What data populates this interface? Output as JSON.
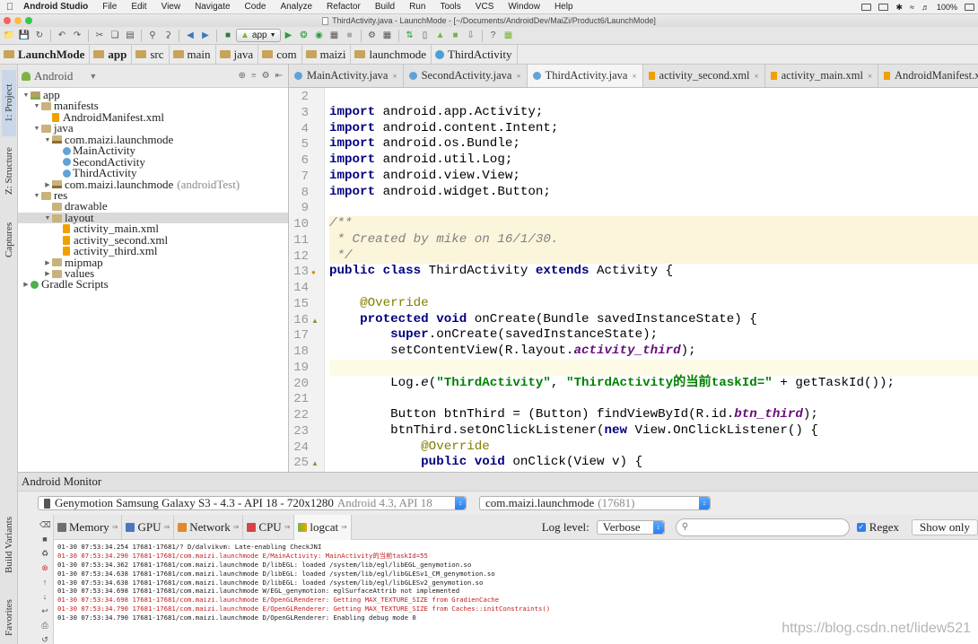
{
  "menubar": {
    "app_name": "Android Studio",
    "items": [
      "File",
      "Edit",
      "View",
      "Navigate",
      "Code",
      "Analyze",
      "Refactor",
      "Build",
      "Run",
      "Tools",
      "VCS",
      "Window",
      "Help"
    ],
    "battery": "100%"
  },
  "window": {
    "title": "ThirdActivity.java - LaunchMode - [~/Documents/AndroidDev/MaiZi/Product6/LaunchMode]"
  },
  "toolbar": {
    "run_config": "app"
  },
  "breadcrumb": [
    "LaunchMode",
    "app",
    "src",
    "main",
    "java",
    "com",
    "maizi",
    "launchmode",
    "ThirdActivity"
  ],
  "left_strip": {
    "tabs": [
      "1: Project",
      "Z: Structure",
      "Captures",
      "Build Variants",
      "Favorites"
    ]
  },
  "project": {
    "view": "Android",
    "tree": [
      {
        "label": "app",
        "depth": 0,
        "icon": "folder-android",
        "arrow": "down"
      },
      {
        "label": "manifests",
        "depth": 1,
        "icon": "folder",
        "arrow": "down"
      },
      {
        "label": "AndroidManifest.xml",
        "depth": 2,
        "icon": "xml",
        "arrow": ""
      },
      {
        "label": "java",
        "depth": 1,
        "icon": "folder",
        "arrow": "down"
      },
      {
        "label": "com.maizi.launchmode",
        "depth": 2,
        "icon": "pkg",
        "arrow": "down"
      },
      {
        "label": "MainActivity",
        "depth": 3,
        "icon": "cls",
        "arrow": ""
      },
      {
        "label": "SecondActivity",
        "depth": 3,
        "icon": "cls",
        "arrow": ""
      },
      {
        "label": "ThirdActivity",
        "depth": 3,
        "icon": "cls",
        "arrow": ""
      },
      {
        "label": "com.maizi.launchmode",
        "depth": 2,
        "icon": "pkg",
        "arrow": "right",
        "note": "(androidTest)"
      },
      {
        "label": "res",
        "depth": 1,
        "icon": "folder",
        "arrow": "down"
      },
      {
        "label": "drawable",
        "depth": 2,
        "icon": "folder",
        "arrow": ""
      },
      {
        "label": "layout",
        "depth": 2,
        "icon": "folder",
        "arrow": "down",
        "selected": true
      },
      {
        "label": "activity_main.xml",
        "depth": 3,
        "icon": "xml",
        "arrow": ""
      },
      {
        "label": "activity_second.xml",
        "depth": 3,
        "icon": "xml",
        "arrow": ""
      },
      {
        "label": "activity_third.xml",
        "depth": 3,
        "icon": "xml",
        "arrow": ""
      },
      {
        "label": "mipmap",
        "depth": 2,
        "icon": "folder",
        "arrow": "right"
      },
      {
        "label": "values",
        "depth": 2,
        "icon": "folder",
        "arrow": "right"
      },
      {
        "label": "Gradle Scripts",
        "depth": 0,
        "icon": "gradle",
        "arrow": "right"
      }
    ]
  },
  "editor": {
    "tabs": [
      {
        "label": "MainActivity.java",
        "type": "java",
        "active": false
      },
      {
        "label": "SecondActivity.java",
        "type": "java",
        "active": false
      },
      {
        "label": "ThirdActivity.java",
        "type": "java",
        "active": true
      },
      {
        "label": "activity_second.xml",
        "type": "xml",
        "active": false
      },
      {
        "label": "activity_main.xml",
        "type": "xml",
        "active": false
      },
      {
        "label": "AndroidManifest.xml",
        "type": "xml",
        "active": false
      }
    ],
    "line_numbers": [
      "2",
      "3",
      "4",
      "5",
      "6",
      "7",
      "8",
      "9",
      "10",
      "11",
      "12",
      "13",
      "14",
      "15",
      "16",
      "17",
      "18",
      "19",
      "20",
      "21",
      "22",
      "23",
      "24",
      "25"
    ],
    "lines": [
      [],
      [
        {
          "t": "import",
          "c": "kw"
        },
        {
          "t": " android.app.Activity;",
          "c": ""
        }
      ],
      [
        {
          "t": "import",
          "c": "kw"
        },
        {
          "t": " android.content.Intent;",
          "c": ""
        }
      ],
      [
        {
          "t": "import",
          "c": "kw"
        },
        {
          "t": " android.os.Bundle;",
          "c": ""
        }
      ],
      [
        {
          "t": "import",
          "c": "kw"
        },
        {
          "t": " android.util.Log;",
          "c": ""
        }
      ],
      [
        {
          "t": "import",
          "c": "kw"
        },
        {
          "t": " android.view.View;",
          "c": ""
        }
      ],
      [
        {
          "t": "import",
          "c": "kw"
        },
        {
          "t": " android.widget.Button;",
          "c": ""
        }
      ],
      [],
      [
        {
          "t": "/**",
          "c": "cmt"
        }
      ],
      [
        {
          "t": " * Created by mike on 16/1/30.",
          "c": "cmt"
        }
      ],
      [
        {
          "t": " */",
          "c": "cmt"
        }
      ],
      [
        {
          "t": "public class",
          "c": "kw"
        },
        {
          "t": " ThirdActivity ",
          "c": ""
        },
        {
          "t": "extends",
          "c": "kw"
        },
        {
          "t": " Activity {",
          "c": ""
        }
      ],
      [],
      [
        {
          "t": "    ",
          "c": ""
        },
        {
          "t": "@Override",
          "c": "ann"
        }
      ],
      [
        {
          "t": "    ",
          "c": ""
        },
        {
          "t": "protected void",
          "c": "kw"
        },
        {
          "t": " onCreate(Bundle savedInstanceState) {",
          "c": ""
        }
      ],
      [
        {
          "t": "        ",
          "c": ""
        },
        {
          "t": "super",
          "c": "kw"
        },
        {
          "t": ".onCreate(savedInstanceState);",
          "c": ""
        }
      ],
      [
        {
          "t": "        setContentView(R.layout.",
          "c": ""
        },
        {
          "t": "activity_third",
          "c": "fld"
        },
        {
          "t": ");",
          "c": ""
        }
      ],
      [],
      [
        {
          "t": "        Log.",
          "c": ""
        },
        {
          "t": "e",
          "c": "sm"
        },
        {
          "t": "(",
          "c": ""
        },
        {
          "t": "\"ThirdActivity\"",
          "c": "str"
        },
        {
          "t": ", ",
          "c": ""
        },
        {
          "t": "\"ThirdActivity的当前taskId=\"",
          "c": "str"
        },
        {
          "t": " + getTaskId());",
          "c": ""
        }
      ],
      [],
      [
        {
          "t": "        Button btnThird = (Button) findViewById(R.id.",
          "c": ""
        },
        {
          "t": "btn_third",
          "c": "fld"
        },
        {
          "t": ");",
          "c": ""
        }
      ],
      [
        {
          "t": "        btnThird.setOnClickListener(",
          "c": ""
        },
        {
          "t": "new",
          "c": "kw"
        },
        {
          "t": " View.OnClickListener() {",
          "c": ""
        }
      ],
      [
        {
          "t": "            ",
          "c": ""
        },
        {
          "t": "@Override",
          "c": "ann"
        }
      ],
      [
        {
          "t": "            ",
          "c": ""
        },
        {
          "t": "public void",
          "c": "kw"
        },
        {
          "t": " onClick(View v) {",
          "c": ""
        }
      ]
    ]
  },
  "monitor": {
    "title": "Android Monitor",
    "device": "Genymotion Samsung Galaxy S3 - 4.3 - API 18 - 720x1280",
    "device_detail": "Android 4.3, API 18",
    "process": "com.maizi.launchmode",
    "process_pid": "(17681)",
    "tabs": [
      "Memory",
      "GPU",
      "Network",
      "CPU",
      "logcat"
    ],
    "log_level_label": "Log level:",
    "log_level": "Verbose",
    "search_placeholder": "",
    "regex_label": "Regex",
    "show_only": "Show only",
    "log_lines": [
      {
        "text": "01-30 07:53:34.254 17681-17681/? D/dalvikvm: Late-enabling CheckJNI",
        "level": "d"
      },
      {
        "text": "01-30 07:53:34.290 17681-17681/com.maizi.launchmode E/MainActivity: MainActivity的当前taskId=55",
        "level": "e"
      },
      {
        "text": "01-30 07:53:34.362 17681-17681/com.maizi.launchmode D/libEGL: loaded /system/lib/egl/libEGL_genymotion.so",
        "level": "d"
      },
      {
        "text": "01-30 07:53:34.638 17681-17681/com.maizi.launchmode D/libEGL: loaded /system/lib/egl/libGLESv1_CM_genymotion.so",
        "level": "d"
      },
      {
        "text": "01-30 07:53:34.638 17681-17681/com.maizi.launchmode D/libEGL: loaded /system/lib/egl/libGLESv2_genymotion.so",
        "level": "d"
      },
      {
        "text": "01-30 07:53:34.698 17681-17681/com.maizi.launchmode W/EGL_genymotion: eglSurfaceAttrib not implemented",
        "level": "w"
      },
      {
        "text": "01-30 07:53:34.698 17681-17681/com.maizi.launchmode E/OpenGLRenderer: Getting MAX_TEXTURE_SIZE from GradienCache",
        "level": "e"
      },
      {
        "text": "01-30 07:53:34.790 17681-17681/com.maizi.launchmode E/OpenGLRenderer: Getting MAX_TEXTURE_SIZE from Caches::initConstraints()",
        "level": "e"
      },
      {
        "text": "01-30 07:53:34.790 17681-17681/com.maizi.launchmode D/OpenGLRenderer: Enabling debug mode 0",
        "level": "d"
      }
    ]
  },
  "watermark": "https://blog.csdn.net/lidew521",
  "colors": {
    "keyword": "#000080",
    "annotation": "#808000",
    "comment": "#808080",
    "string": "#008000",
    "error_log": "#c21d1d",
    "android_green": "#7cb342"
  }
}
